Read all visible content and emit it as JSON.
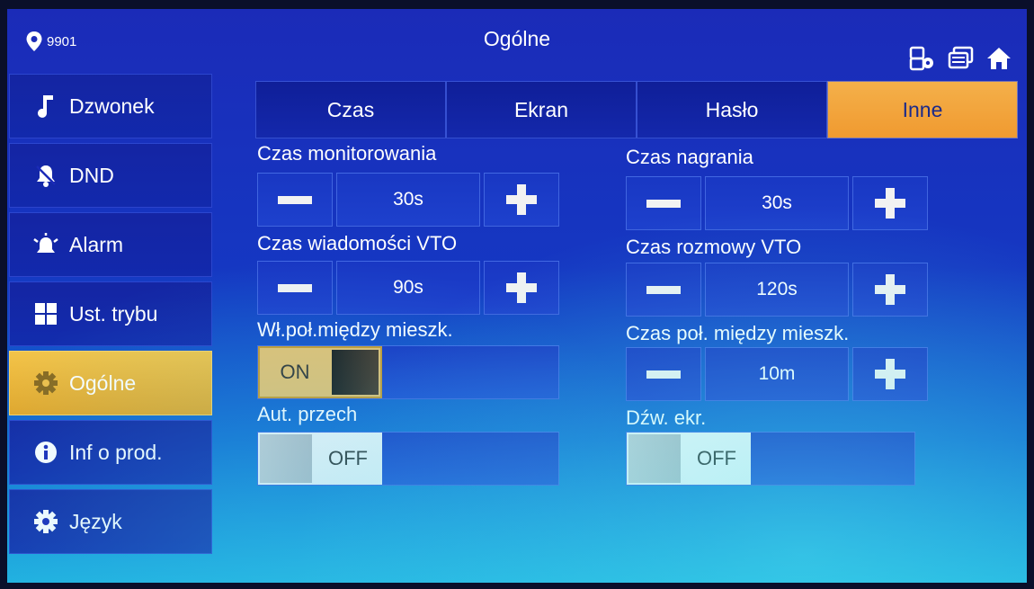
{
  "header": {
    "location_code": "9901",
    "title": "Ogólne",
    "icons": [
      "location-pin-icon",
      "network-settings-icon",
      "windows-icon",
      "home-icon"
    ]
  },
  "sidebar": {
    "items": [
      {
        "label": "Dzwonek",
        "icon": "music-note-icon",
        "active": false
      },
      {
        "label": "DND",
        "icon": "bell-mute-icon",
        "active": false
      },
      {
        "label": "Alarm",
        "icon": "alarm-icon",
        "active": false
      },
      {
        "label": "Ust. trybu",
        "icon": "grid-icon",
        "active": false
      },
      {
        "label": "Ogólne",
        "icon": "gear-icon",
        "active": true
      },
      {
        "label": "Inf o prod.",
        "icon": "info-icon",
        "active": false
      },
      {
        "label": "Język",
        "icon": "gear-icon",
        "active": false
      }
    ]
  },
  "tabs": [
    {
      "label": "Czas",
      "active": false
    },
    {
      "label": "Ekran",
      "active": false
    },
    {
      "label": "Hasło",
      "active": false
    },
    {
      "label": "Inne",
      "active": true
    }
  ],
  "settings": {
    "monitoring_time": {
      "label": "Czas monitorowania",
      "value": "30s"
    },
    "recording_time": {
      "label": "Czas nagrania",
      "value": "30s"
    },
    "vto_message_time": {
      "label": "Czas wiadomości VTO",
      "value": "90s"
    },
    "vto_talk_time": {
      "label": "Czas rozmowy VTO",
      "value": "120s"
    },
    "intercom_enable": {
      "label": "Wł.poł.między mieszk.",
      "state": "ON"
    },
    "intercom_time": {
      "label": "Czas poł. między mieszk.",
      "value": "10m"
    },
    "auto_snapshot": {
      "label": "Aut. przech",
      "state": "OFF"
    },
    "screen_sound": {
      "label": "Dźw. ekr.",
      "state": "OFF"
    }
  },
  "colors": {
    "accent_active": "#f2c44a",
    "background_top": "#1b2bb8",
    "background_bottom": "#1fb0df"
  }
}
